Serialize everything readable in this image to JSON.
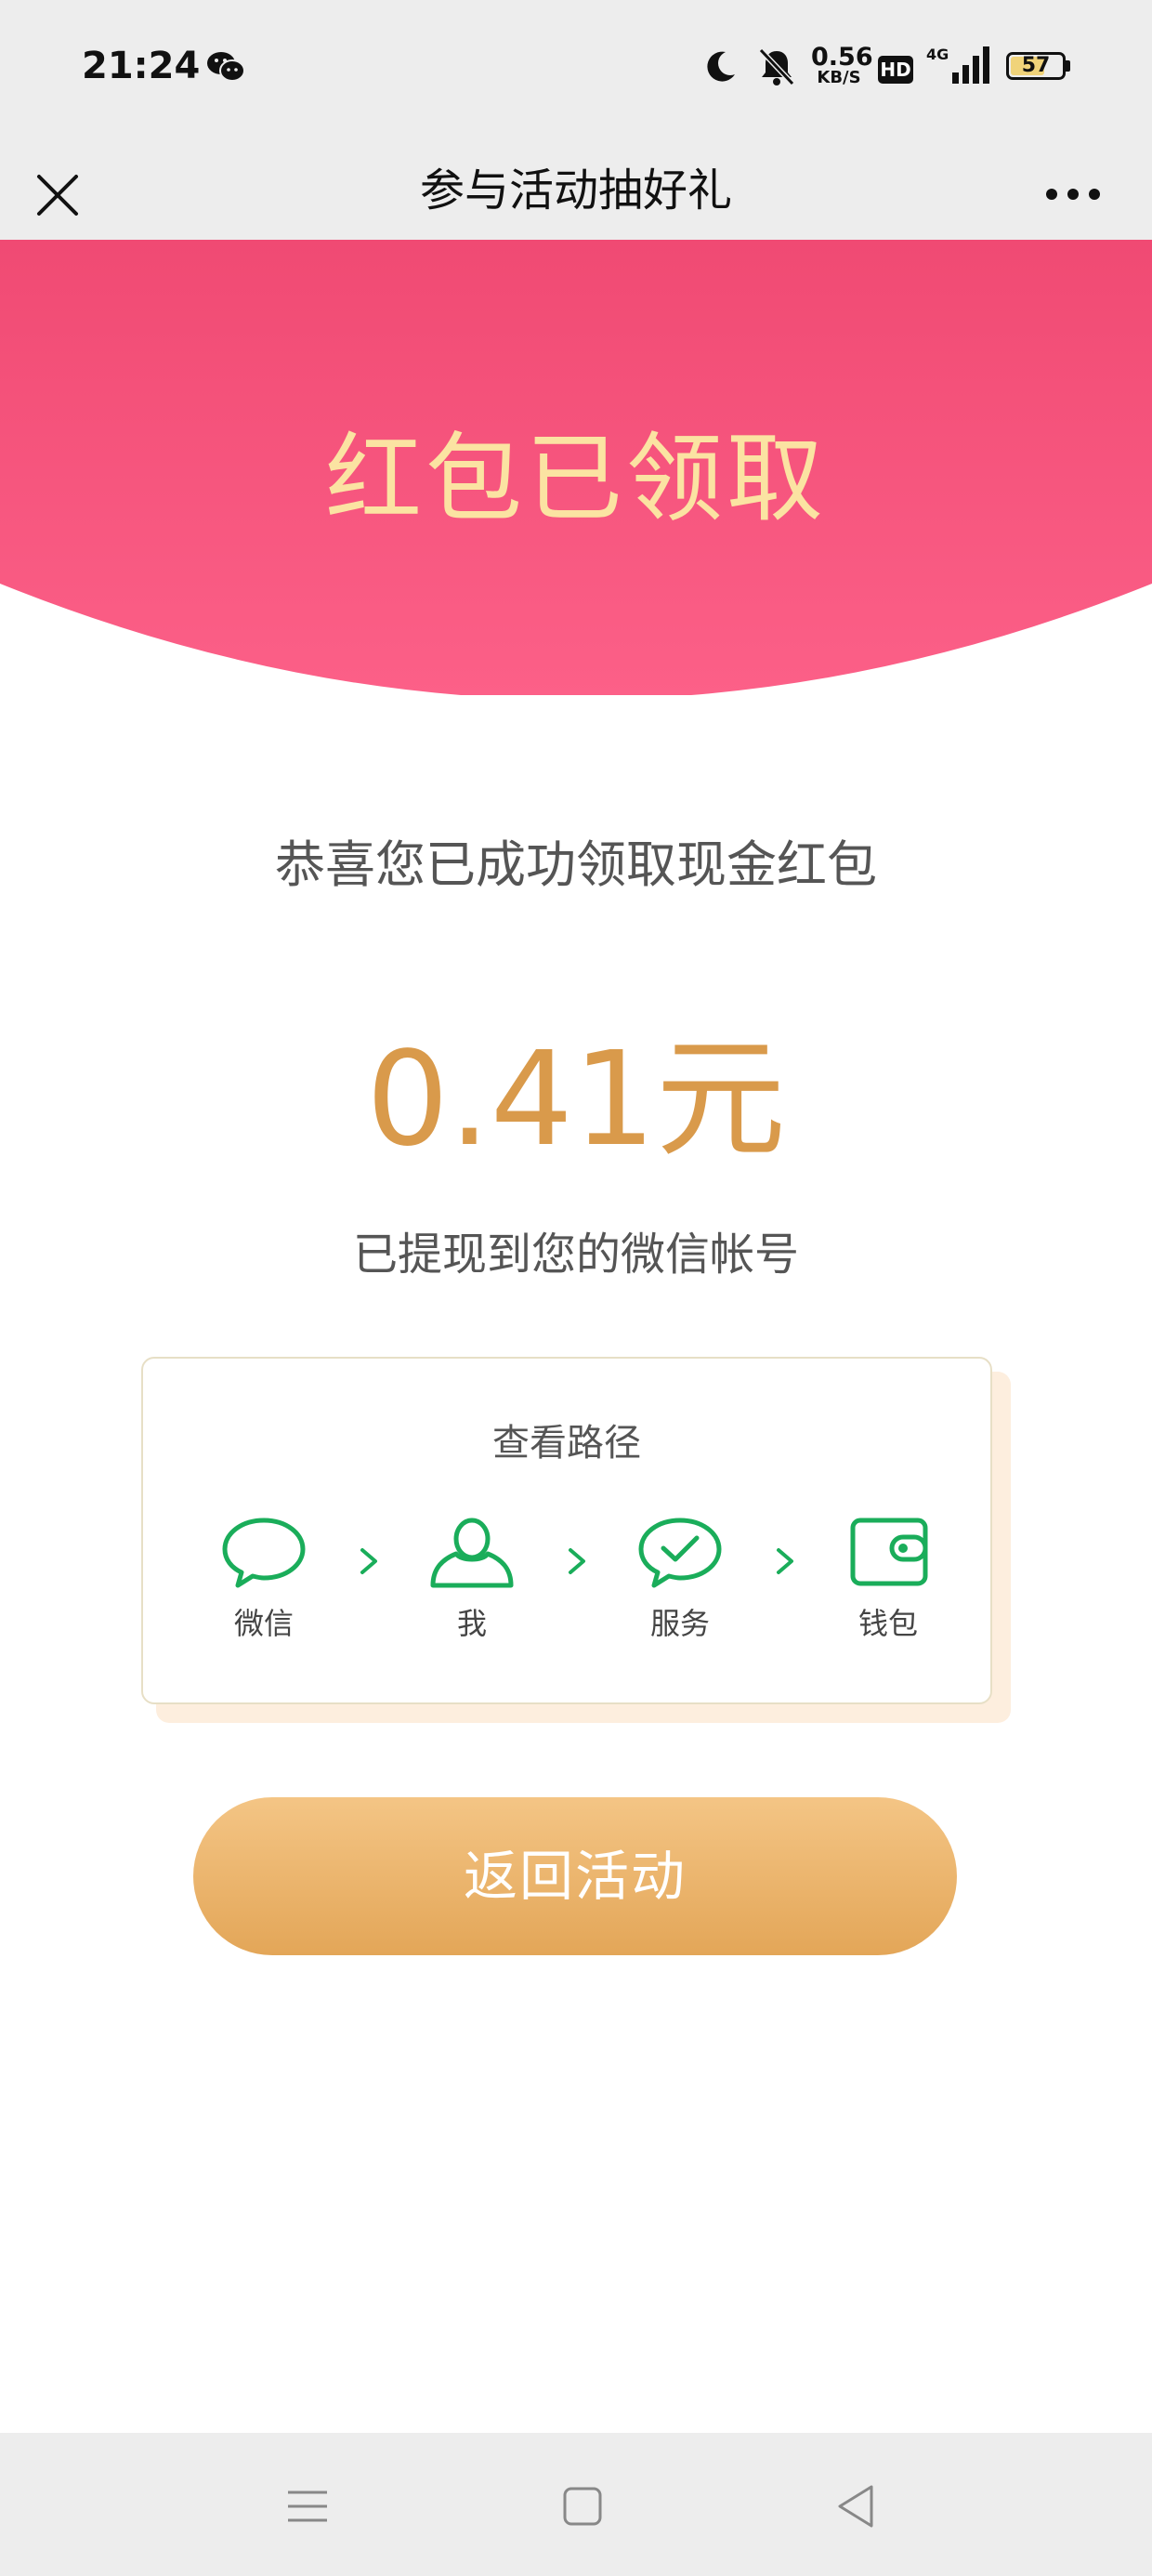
{
  "status_bar": {
    "time": "21:24",
    "net_speed_value": "0.56",
    "net_speed_unit": "KB/S",
    "hd_label": "HD",
    "network_label": "4G",
    "battery_level": "57"
  },
  "nav": {
    "title": "参与活动抽好礼"
  },
  "banner": {
    "title": "红包已领取"
  },
  "main": {
    "congrats_text": "恭喜您已成功领取现金红包",
    "amount": "0.41元",
    "withdrawn_text": "已提现到您的微信帐号"
  },
  "path_card": {
    "title": "查看路径",
    "steps": [
      {
        "label": "微信",
        "icon": "chat-bubble-icon"
      },
      {
        "label": "我",
        "icon": "person-icon"
      },
      {
        "label": "服务",
        "icon": "check-bubble-icon"
      },
      {
        "label": "钱包",
        "icon": "wallet-icon"
      }
    ]
  },
  "actions": {
    "return_label": "返回活动"
  },
  "colors": {
    "banner_top": "#f04a73",
    "banner_bottom": "#fc6088",
    "banner_text": "#fbe3a2",
    "amount": "#d99a4b",
    "icon_green": "#1aad5a",
    "button_top": "#f4c585",
    "button_bottom": "#e3a658"
  }
}
